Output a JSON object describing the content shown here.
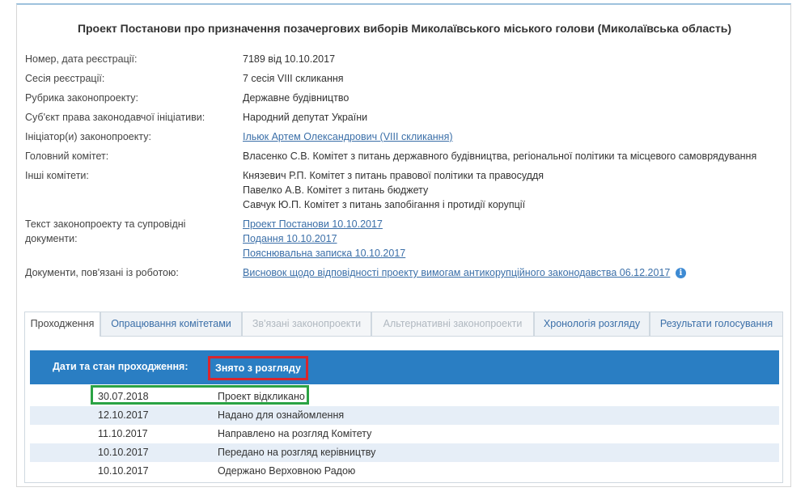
{
  "title": "Проект Постанови про призначення позачергових виборів Миколаївського міського голови (Миколаївська область)",
  "fields": {
    "registration": {
      "label": "Номер, дата реєстрації:",
      "value": "7189 від 10.10.2017"
    },
    "session": {
      "label": "Сесія реєстрації:",
      "value": "7 сесія VIII скликання"
    },
    "rubric": {
      "label": "Рубрика законопроекту:",
      "value": "Державне будівництво"
    },
    "subject": {
      "label": "Суб'єкт права законодавчої ініціативи:",
      "value": "Народний депутат України"
    },
    "initiator": {
      "label": "Ініціатор(и) законопроекту:",
      "value": "Ільюк Артем Олександрович (VIII скликання)"
    },
    "main_committee": {
      "label": "Головний комітет:",
      "value": "Власенко С.В. Комітет з питань державного будівництва, регіональної політики та місцевого самоврядування"
    },
    "other_committees": {
      "label": "Інші комітети:",
      "values": [
        "Князевич Р.П. Комітет з питань правової політики та правосуддя",
        "Павелко А.В. Комітет з питань бюджету",
        "Савчук Ю.П. Комітет з питань запобігання і протидії корупції"
      ]
    },
    "documents": {
      "label_line1": "Текст законопроекту та супровідні",
      "label_line2": "документи:",
      "links": [
        "Проект Постанови 10.10.2017",
        "Подання 10.10.2017",
        "Пояснювальна записка 10.10.2017"
      ]
    },
    "related_docs": {
      "label": "Документи, пов'язані із роботою:",
      "link": "Висновок щодо відповідності проекту вимогам антикорупційного законодавства 06.12.2017",
      "info_icon": "i"
    }
  },
  "tabs": [
    {
      "label": "Проходження",
      "state": "active"
    },
    {
      "label": "Опрацювання комітетами",
      "state": "normal"
    },
    {
      "label": "Зв'язані законопроекти",
      "state": "disabled"
    },
    {
      "label": "Альтернативні законопроекти",
      "state": "disabled"
    },
    {
      "label": "Хронологія розгляду",
      "state": "normal"
    },
    {
      "label": "Результати голосування",
      "state": "normal"
    }
  ],
  "status": {
    "label": "Дати та стан проходження:",
    "value": "Знято з розгляду"
  },
  "history": [
    {
      "date": "30.07.2018",
      "event": "Проект відкликано"
    },
    {
      "date": "12.10.2017",
      "event": "Надано для ознайомлення"
    },
    {
      "date": "11.10.2017",
      "event": "Направлено на розгляд Комітету"
    },
    {
      "date": "10.10.2017",
      "event": "Передано на розгляд керівництву"
    },
    {
      "date": "10.10.2017",
      "event": "Одержано Верховною Радою"
    }
  ],
  "colors": {
    "status_bar": "#2a7ec3",
    "status_highlight_border": "#d8262e",
    "row_highlight_border": "#2aa344",
    "link": "#3b6fa8"
  }
}
